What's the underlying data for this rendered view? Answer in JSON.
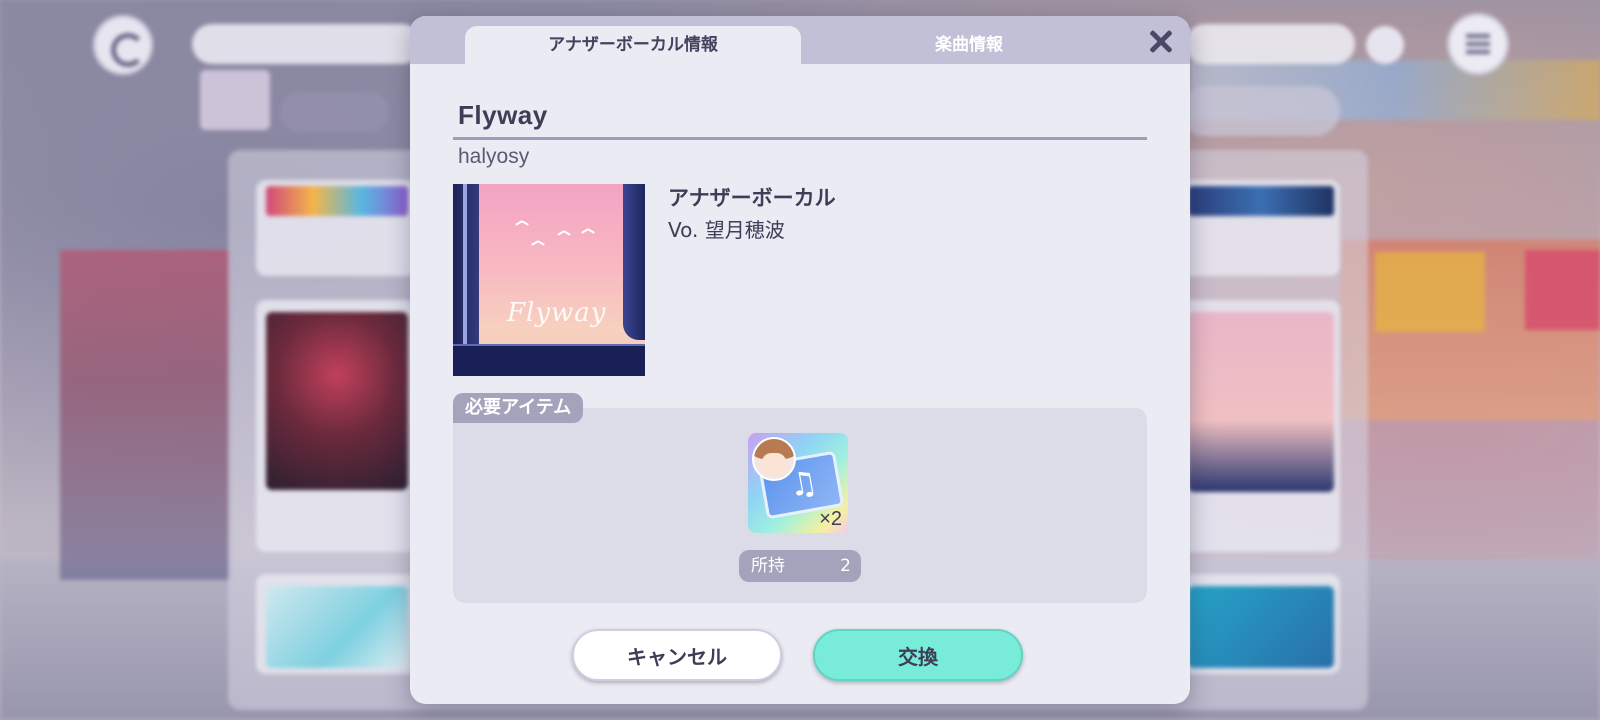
{
  "background": {
    "search_placeholder": "",
    "sort_label": ""
  },
  "dialog": {
    "tabs": [
      {
        "label": "アナザーボーカル情報",
        "active": true
      },
      {
        "label": "楽曲情報",
        "active": false
      }
    ],
    "song_title": "Flyway",
    "artist": "halyosy",
    "jacket_text": "Flyway",
    "vocal_type": "アナザーボーカル",
    "vocalist": "Vo. 望月穂波",
    "required_items_label": "必要アイテム",
    "item": {
      "icon": "another-vocal-ticket-icon",
      "quantity": "×2",
      "owned_label": "所持",
      "owned_count": "2"
    },
    "buttons": {
      "cancel": "キャンセル",
      "exchange": "交換"
    }
  },
  "colors": {
    "accent": "#78ecd9",
    "tab_bar": "#c2c0d6",
    "text": "#3e3d58",
    "label_bg": "#a4a3bb"
  }
}
